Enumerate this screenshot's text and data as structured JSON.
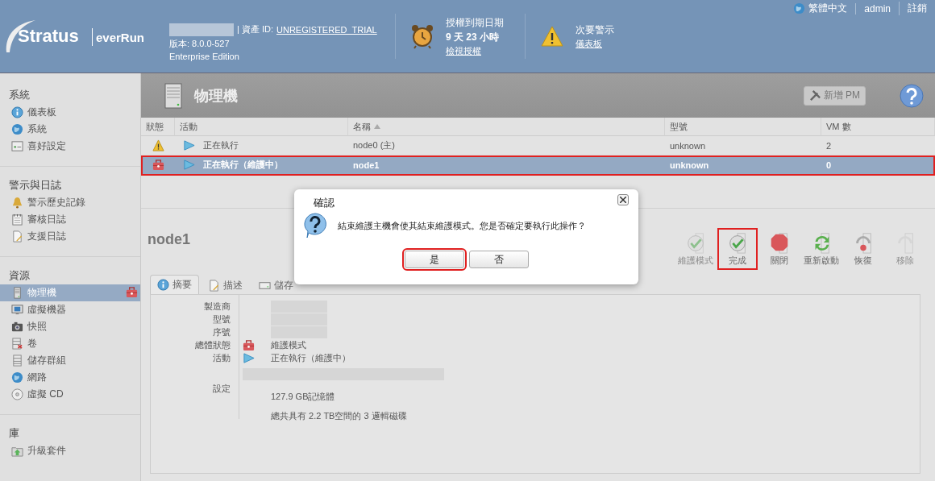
{
  "header": {
    "logo": {
      "brand": "Stratus",
      "product": "everRun"
    },
    "product_name_redacted": true,
    "asset_label": "| 資產 ID:",
    "asset_id": "UNREGISTERED_TRIAL",
    "version": "版本: 8.0.0-527",
    "edition": "Enterprise Edition",
    "license": {
      "title": "授權到期日期",
      "remaining": "9 天 23 小時",
      "link": "檢視授權"
    },
    "alert": {
      "title": "次要警示",
      "link": "儀表板"
    },
    "top_links": [
      {
        "label": "繁體中文",
        "kind": "language"
      },
      {
        "label": "admin",
        "kind": "plain"
      },
      {
        "label": "註銷",
        "kind": "plain"
      }
    ]
  },
  "sidebar": {
    "sections": [
      {
        "title": "系統",
        "items": [
          {
            "label": "儀表板",
            "kind": "info",
            "selected": false
          },
          {
            "label": "系統",
            "kind": "globe",
            "selected": false
          },
          {
            "label": "喜好設定",
            "kind": "window",
            "selected": false
          }
        ]
      },
      {
        "title": "警示與日誌",
        "items": [
          {
            "label": "警示歷史記錄",
            "kind": "bell",
            "selected": false
          },
          {
            "label": "審核日誌",
            "kind": "calendar",
            "selected": false
          },
          {
            "label": "支援日誌",
            "kind": "document",
            "selected": false
          }
        ]
      },
      {
        "title": "資源",
        "items": [
          {
            "label": "物理機",
            "kind": "server",
            "selected": true,
            "maintenance": true
          },
          {
            "label": "虛擬機器",
            "kind": "monitor",
            "selected": false
          },
          {
            "label": "快照",
            "kind": "camera",
            "selected": false
          },
          {
            "label": "卷",
            "kind": "volume",
            "selected": false
          },
          {
            "label": "儲存群組",
            "kind": "stack",
            "selected": false
          },
          {
            "label": "網路",
            "kind": "globe",
            "selected": false
          },
          {
            "label": "虛擬 CD",
            "kind": "disc",
            "selected": false
          }
        ]
      },
      {
        "title": "庫",
        "items": [
          {
            "label": "升級套件",
            "kind": "upgrade",
            "selected": false
          }
        ]
      }
    ]
  },
  "page": {
    "title": "物理機",
    "add_button": {
      "label": "新增 PM",
      "disabled": true
    }
  },
  "table": {
    "columns": [
      {
        "label": "狀態",
        "sorted": false
      },
      {
        "label": "活動",
        "sorted": false
      },
      {
        "label": "名稱",
        "sorted": true
      },
      {
        "label": "型號",
        "sorted": false
      },
      {
        "label": "VM 數",
        "sorted": false
      }
    ],
    "rows": [
      {
        "kind": "warning",
        "activity": "正在執行",
        "name": "node0",
        "name_suffix": "(主)",
        "model": "unknown",
        "vm_count": "2",
        "selected": false,
        "highlighted": false
      },
      {
        "kind": "maintenance",
        "activity": "正在執行（維護中）",
        "name": "node1",
        "model": "unknown",
        "vm_count": "0",
        "selected": true,
        "highlighted": true
      }
    ]
  },
  "detail": {
    "title": "node1",
    "actions": [
      {
        "label": "維護模式",
        "kind": "check",
        "disabled": true,
        "highlighted": false
      },
      {
        "label": "完成",
        "kind": "check",
        "disabled": false,
        "highlighted": true
      },
      {
        "label": "關閉",
        "kind": "stop",
        "disabled": false,
        "highlighted": false
      },
      {
        "label": "重新啟動",
        "kind": "refresh",
        "disabled": false,
        "highlighted": false
      },
      {
        "label": "恢復",
        "kind": "undo",
        "disabled": false,
        "highlighted": false
      },
      {
        "label": "移除",
        "kind": "remove",
        "disabled": true,
        "highlighted": false
      }
    ],
    "tabs": [
      {
        "label": "摘要",
        "kind": "info",
        "selected": true
      },
      {
        "label": "描述",
        "kind": "document",
        "selected": false
      },
      {
        "label": "儲存",
        "kind": "drive",
        "selected": false
      }
    ],
    "fields": [
      {
        "label": "製造商",
        "redacted": true
      },
      {
        "label": "型號",
        "redacted": true
      },
      {
        "label": "序號",
        "redacted": true
      },
      {
        "label": "總體狀態",
        "kind": "maintenance",
        "value": "維護模式"
      },
      {
        "label": "活動",
        "kind": "running",
        "value": "正在執行（維護中）",
        "note_redacted": true
      },
      {
        "label": "設定",
        "values": [
          "127.9 GB記憶體",
          "總共具有 2.2 TB空間的 3 邏輯磁碟"
        ]
      }
    ]
  },
  "dialog": {
    "title": "確認",
    "message": "結束維護主機會使其結束維護模式。您是否確定要執行此操作？",
    "buttons": [
      {
        "label": "是",
        "highlighted": true
      },
      {
        "label": "否",
        "highlighted": false
      }
    ]
  }
}
